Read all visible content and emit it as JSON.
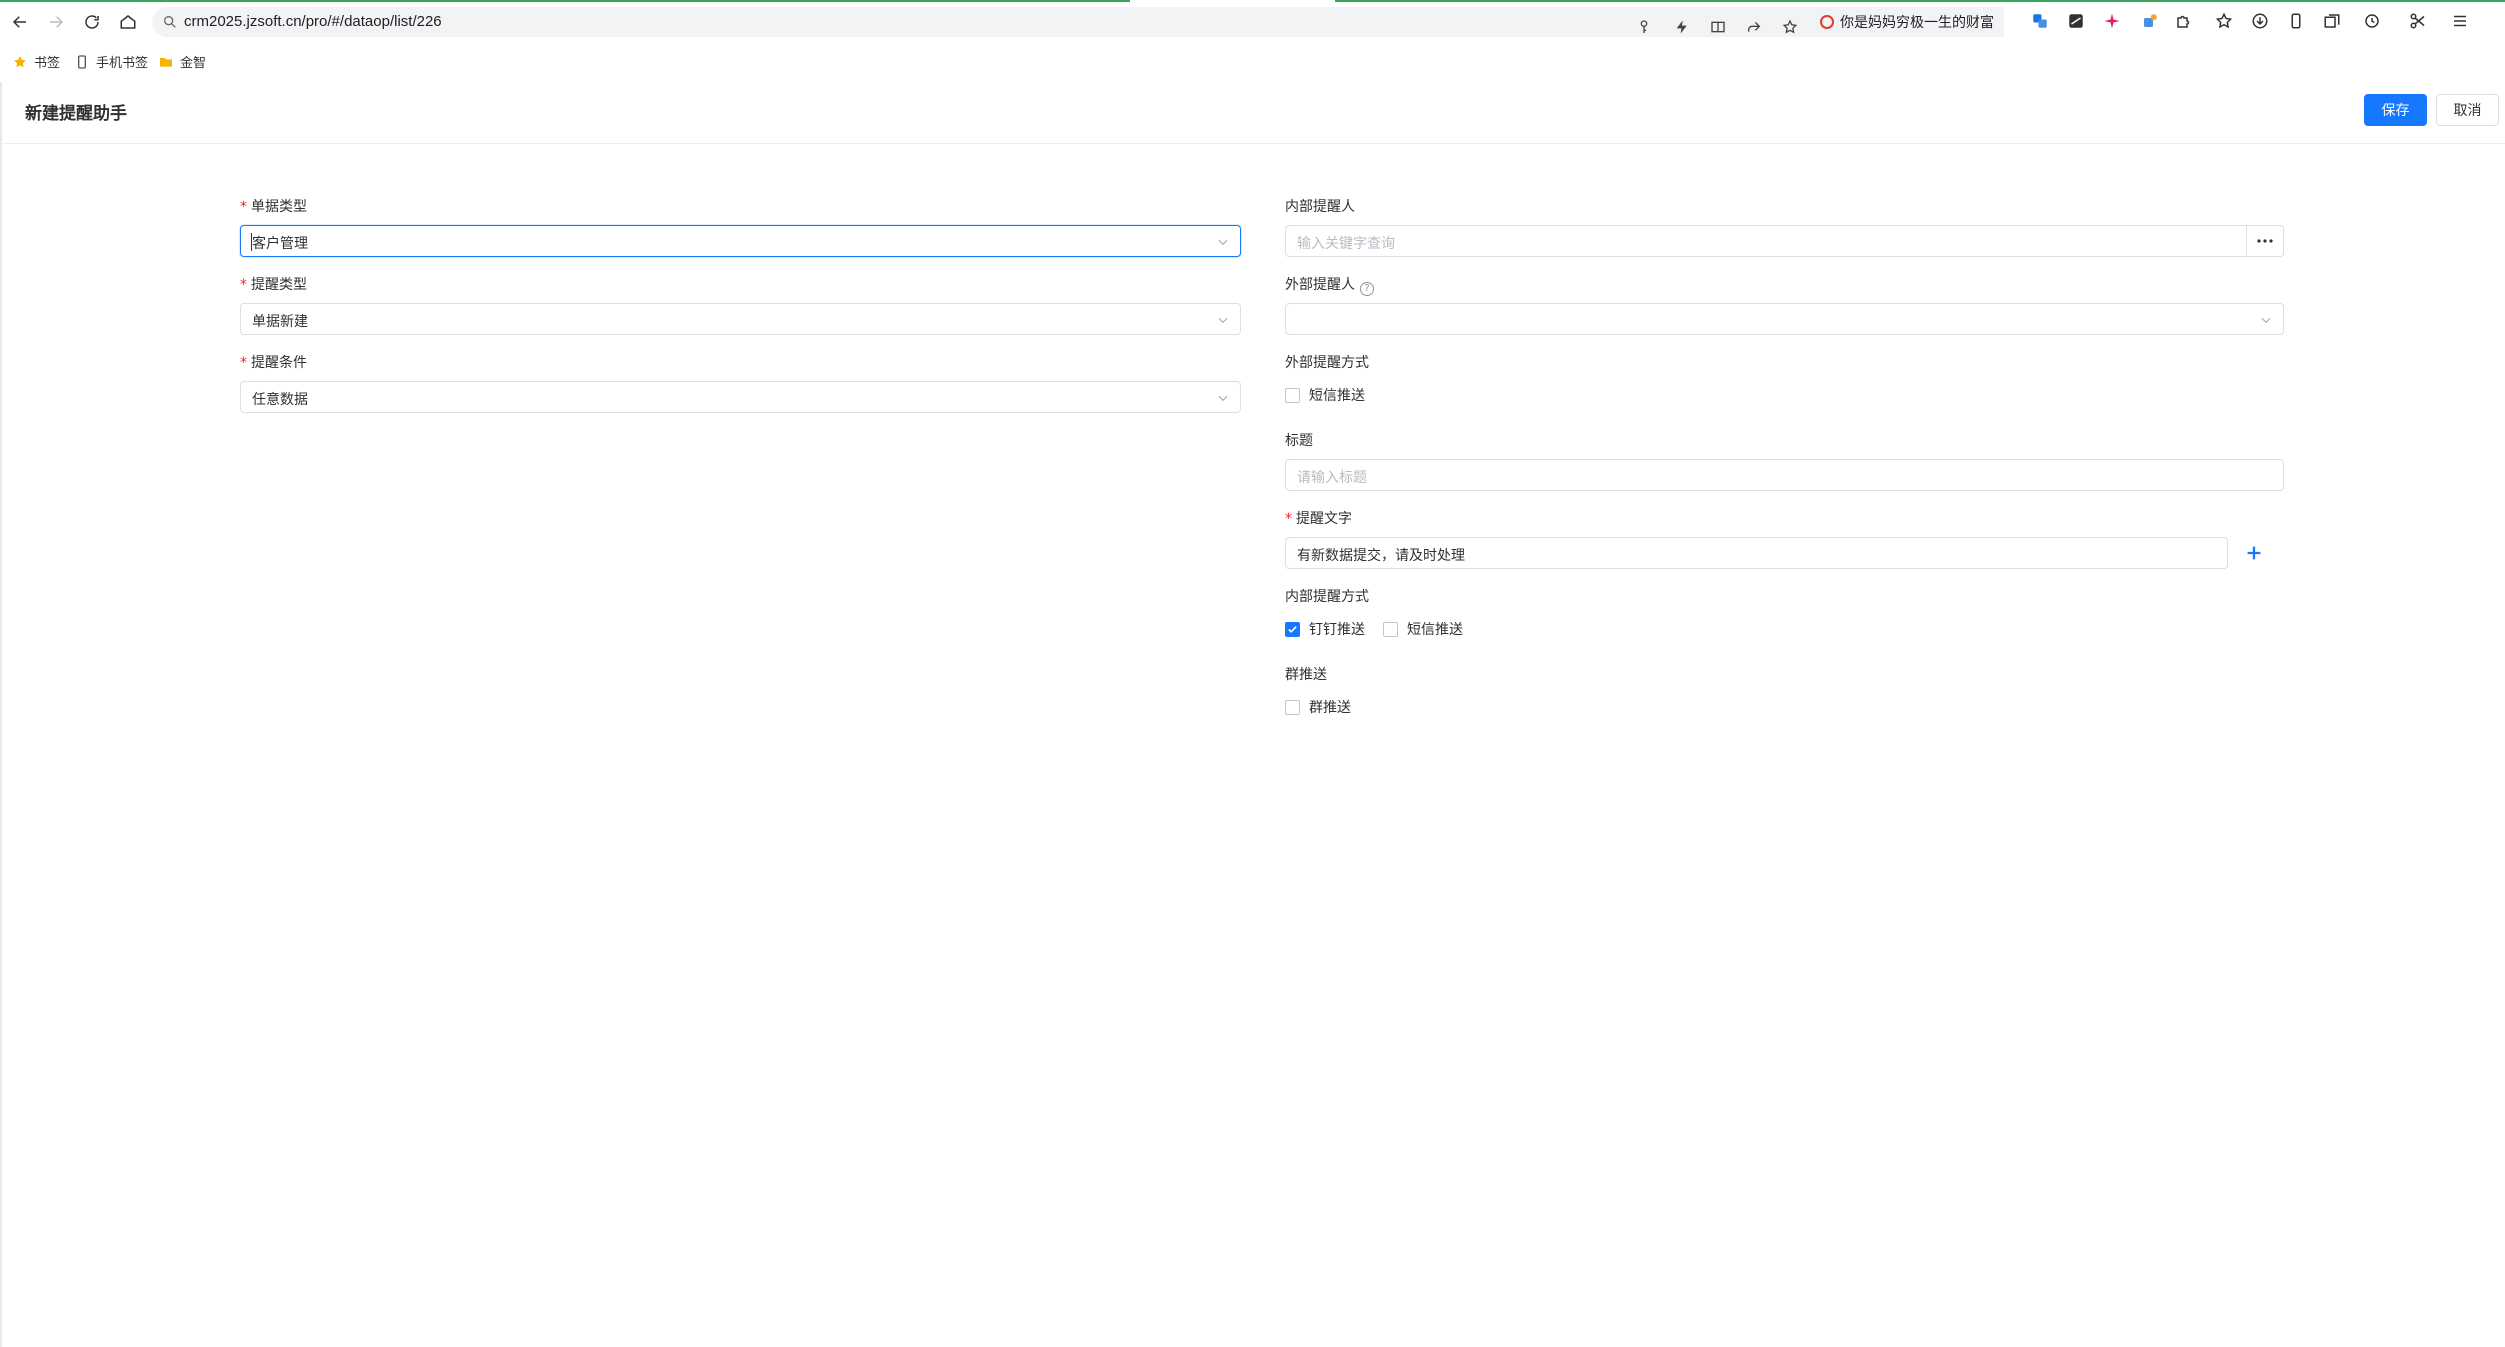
{
  "browser": {
    "url": "crm2025.jzsoft.cn/pro/#/dataop/list/226",
    "promo_text": "你是妈妈穷极一生的财富",
    "bookmarks": [
      {
        "label": "书签",
        "icon": "star-icon"
      },
      {
        "label": "手机书签",
        "icon": "phone-icon"
      },
      {
        "label": "金智",
        "icon": "folder-icon"
      }
    ]
  },
  "page": {
    "title": "新建提醒助手",
    "save_label": "保存",
    "cancel_label": "取消"
  },
  "form": {
    "doc_type": {
      "label": "单据类型",
      "value": "客户管理"
    },
    "remind_type": {
      "label": "提醒类型",
      "value": "单据新建"
    },
    "remind_condition": {
      "label": "提醒条件",
      "value": "任意数据"
    },
    "internal_reminder": {
      "label": "内部提醒人",
      "placeholder": "输入关键字查询"
    },
    "external_reminder": {
      "label": "外部提醒人",
      "value": ""
    },
    "external_method": {
      "label": "外部提醒方式",
      "options": [
        {
          "label": "短信推送",
          "checked": false
        }
      ]
    },
    "title": {
      "label": "标题",
      "placeholder": "请输入标题"
    },
    "remind_text": {
      "label": "提醒文字",
      "value": "有新数据提交，请及时处理"
    },
    "internal_method": {
      "label": "内部提醒方式",
      "options": [
        {
          "label": "钉钉推送",
          "checked": true
        },
        {
          "label": "短信推送",
          "checked": false
        }
      ]
    },
    "group_push": {
      "label": "群推送",
      "options": [
        {
          "label": "群推送",
          "checked": false
        }
      ]
    }
  },
  "colors": {
    "primary": "#1677ff",
    "required": "#f5222d"
  }
}
